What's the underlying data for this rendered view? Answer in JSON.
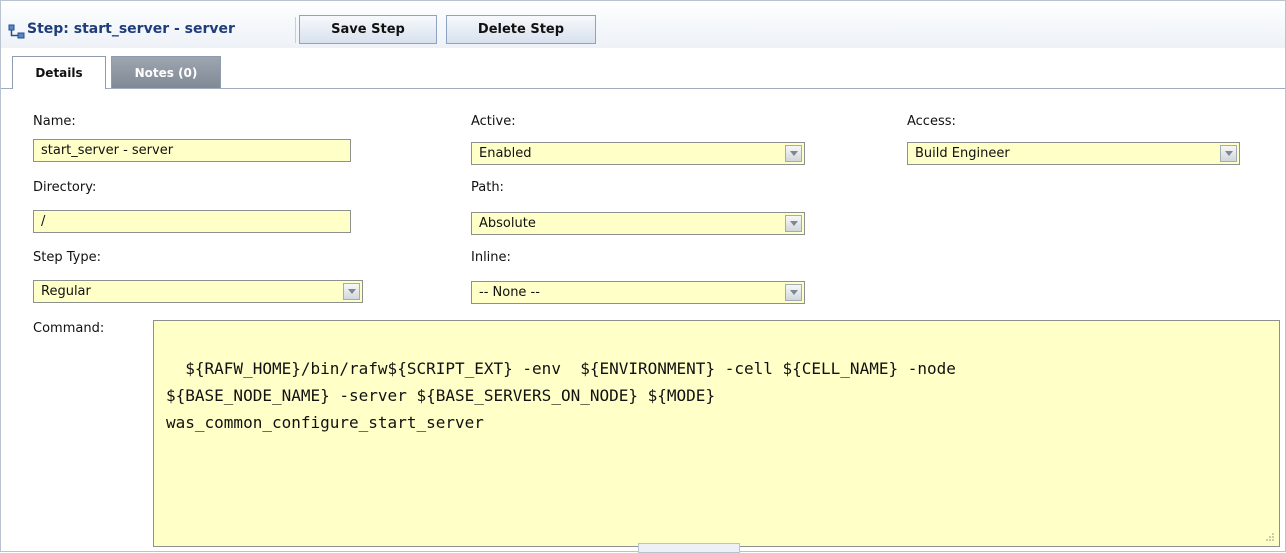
{
  "header": {
    "title": "Step: start_server - server",
    "save_label": "Save Step",
    "delete_label": "Delete Step",
    "step_icon": "step-icon"
  },
  "tabs": [
    {
      "label": "Details",
      "active": true
    },
    {
      "label": "Notes (0)",
      "active": false
    }
  ],
  "form": {
    "name": {
      "label": "Name:",
      "value": "start_server - server"
    },
    "directory": {
      "label": "Directory:",
      "value": "/"
    },
    "step_type": {
      "label": "Step Type:",
      "value": "Regular",
      "icon": "chevron-down-icon"
    },
    "active": {
      "label": "Active:",
      "value": "Enabled",
      "icon": "chevron-down-icon"
    },
    "path": {
      "label": "Path:",
      "value": "Absolute",
      "icon": "chevron-down-icon"
    },
    "inline": {
      "label": "Inline:",
      "value": "-- None --",
      "icon": "chevron-down-icon"
    },
    "access": {
      "label": "Access:",
      "value": "Build Engineer",
      "icon": "chevron-down-icon"
    },
    "command": {
      "label": "Command:",
      "value": "${RAFW_HOME}/bin/rafw${SCRIPT_EXT} -env  ${ENVIRONMENT} -cell ${CELL_NAME} -node\n${BASE_NODE_NAME} -server ${BASE_SERVERS_ON_NODE} ${MODE}\nwas_common_configure_start_server"
    }
  },
  "colors": {
    "field_background": "#ffffc8",
    "title_color": "#1f3d7a",
    "tab_inactive": "#8b939e"
  }
}
